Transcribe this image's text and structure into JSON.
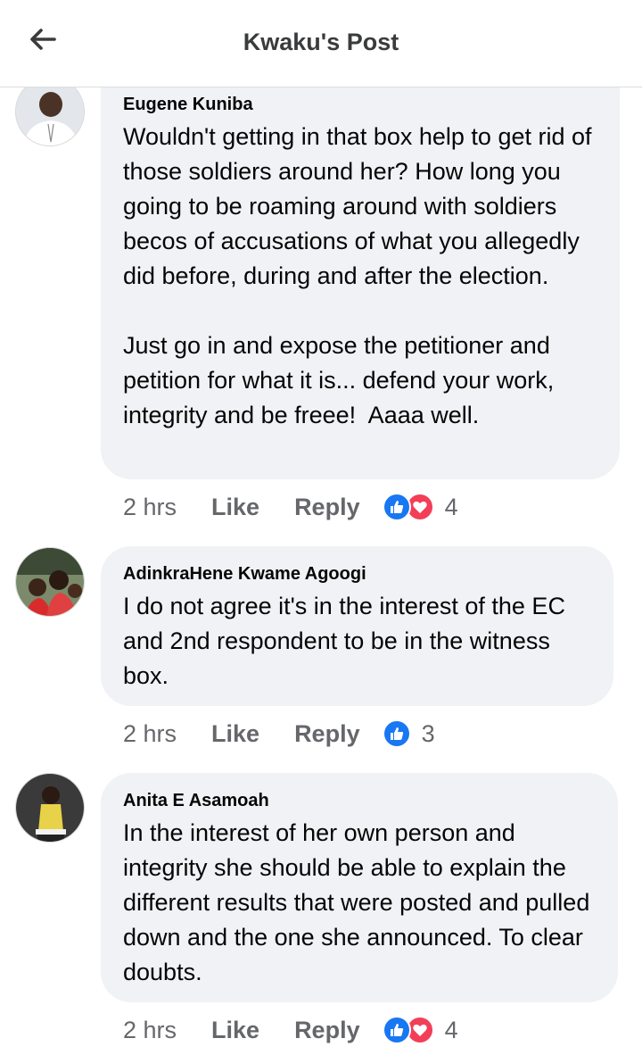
{
  "header": {
    "title": "Kwaku's Post"
  },
  "comments": [
    {
      "author": "Eugene Kuniba",
      "text": "Wouldn't getting in that box help to get rid of those soldiers around her? How long you going to be roaming around with soldiers becos of accusations of what you allegedly did before, during and after the election.\n\nJust go in and expose the petitioner and petition for what it is... defend your work, integrity and be freee!  Aaaa well.",
      "time": "2 hrs",
      "like": "Like",
      "reply": "Reply",
      "reaction_count": "4",
      "reactions": [
        "like-icon",
        "love-icon"
      ]
    },
    {
      "author": "AdinkraHene Kwame Agoogi",
      "text": "I do not agree it's in the interest of the EC and 2nd respondent to be in the witness box.",
      "time": "2 hrs",
      "like": "Like",
      "reply": "Reply",
      "reaction_count": "3",
      "reactions": [
        "like-icon"
      ]
    },
    {
      "author": "Anita E Asamoah",
      "text": "In the interest of her own person and integrity she should be able to explain the different results that were posted and pulled down and the one she announced. To clear doubts.",
      "time": "2 hrs",
      "like": "Like",
      "reply": "Reply",
      "reaction_count": "4",
      "reactions": [
        "like-icon",
        "love-icon"
      ]
    }
  ],
  "colors": {
    "bubble": "#f0f2f5",
    "like_blue": "#1877f2",
    "love_red": "#f33e58",
    "meta_gray": "#65676b"
  }
}
